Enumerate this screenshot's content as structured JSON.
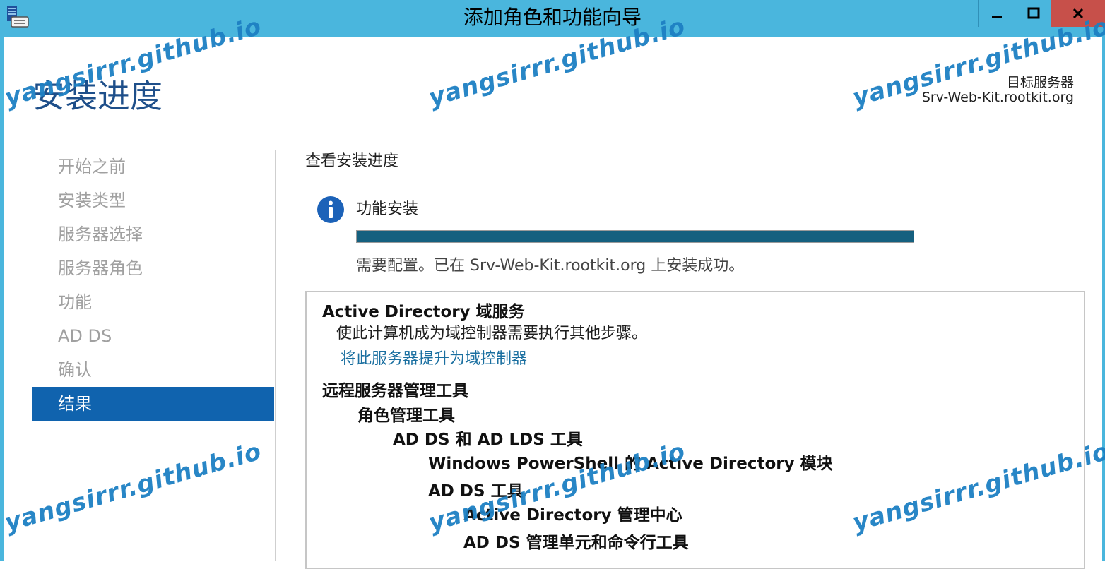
{
  "window": {
    "title": "添加角色和功能向导",
    "minimize_glyph": "—",
    "maximize_glyph": "☐",
    "close_glyph": "✕"
  },
  "header": {
    "page_title": "安装进度",
    "target_label": "目标服务器",
    "target_value": "Srv-Web-Kit.rootkit.org"
  },
  "nav": {
    "items": [
      {
        "label": "开始之前",
        "active": false
      },
      {
        "label": "安装类型",
        "active": false
      },
      {
        "label": "服务器选择",
        "active": false
      },
      {
        "label": "服务器角色",
        "active": false
      },
      {
        "label": "功能",
        "active": false
      },
      {
        "label": "AD DS",
        "active": false
      },
      {
        "label": "确认",
        "active": false
      },
      {
        "label": "结果",
        "active": true
      }
    ]
  },
  "main": {
    "section_title": "查看安装进度",
    "feature_title": "功能安装",
    "progress": 1.0,
    "status": "需要配置。已在 Srv-Web-Kit.rootkit.org 上安装成功。"
  },
  "results": {
    "adds_heading": "Active Directory 域服务",
    "adds_desc": "使此计算机成为域控制器需要执行其他步骤。",
    "promote_link": "将此服务器提升为域控制器",
    "rsat_heading": "远程服务器管理工具",
    "role_tools": "角色管理工具",
    "adds_adlds_tools": "AD DS 和 AD LDS 工具",
    "ps_module": "Windows PowerShell 的 Active Directory 模块",
    "adds_tools": "AD DS 工具",
    "admin_center": "Active Directory 管理中心",
    "snapins": "AD DS 管理单元和命令行工具"
  },
  "watermark": "yangsirrr.github.io",
  "colors": {
    "titlebar": "#4ab6dd",
    "close_button": "#c7504a",
    "active_nav": "#1063ae",
    "progress_fill": "#15607f",
    "link": "#1a6fa0",
    "watermark": "#1d80c3"
  }
}
